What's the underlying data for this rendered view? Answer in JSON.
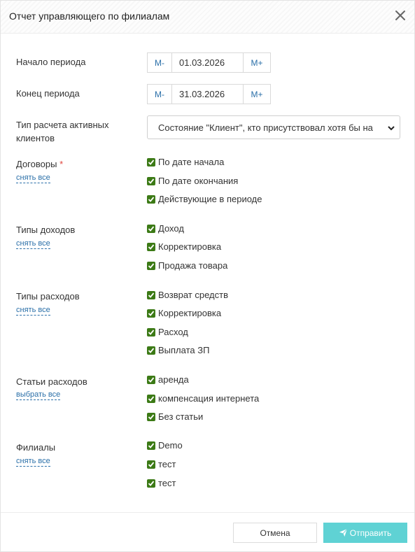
{
  "dialog": {
    "title": "Отчет управляющего по филиалам"
  },
  "period": {
    "start_label": "Начало периода",
    "end_label": "Конец периода",
    "minus_label": "M-",
    "plus_label": "M+",
    "start_value": "01.03.2026",
    "end_value": "31.03.2026"
  },
  "calc_type": {
    "label": "Тип расчета активных клиентов",
    "selected": "Состояние \"Клиент\", кто присутствовал хотя бы на"
  },
  "contracts": {
    "label": "Договоры",
    "required_mark": "*",
    "link": "снять все",
    "options": [
      "По дате начала",
      "По дате окончания",
      "Действующие в периоде"
    ]
  },
  "income_types": {
    "label": "Типы доходов",
    "link": "снять все",
    "options": [
      "Доход",
      "Корректировка",
      "Продажа товара"
    ]
  },
  "expense_types": {
    "label": "Типы расходов",
    "link": "снять все",
    "options": [
      "Возврат средств",
      "Корректировка",
      "Расход",
      "Выплата ЗП"
    ]
  },
  "expense_items": {
    "label": "Статьи расходов",
    "link": "выбрать все",
    "options": [
      "аренда",
      "компенсация интернета",
      "Без статьи"
    ]
  },
  "branches": {
    "label": "Филиалы",
    "link": "снять все",
    "options": [
      "Demo",
      "тест",
      "тест"
    ]
  },
  "footer": {
    "cancel_label": "Отмена",
    "send_label": "Отправить"
  },
  "colors": {
    "accent": "#5fd2d4",
    "checkbox": "#3c7a16",
    "link": "#2a6fa8",
    "required": "#e0453d"
  },
  "icons": {
    "close": "close-icon",
    "dropdown": "chevron-down-icon",
    "checkbox": "check-icon",
    "send": "paper-plane-icon"
  }
}
